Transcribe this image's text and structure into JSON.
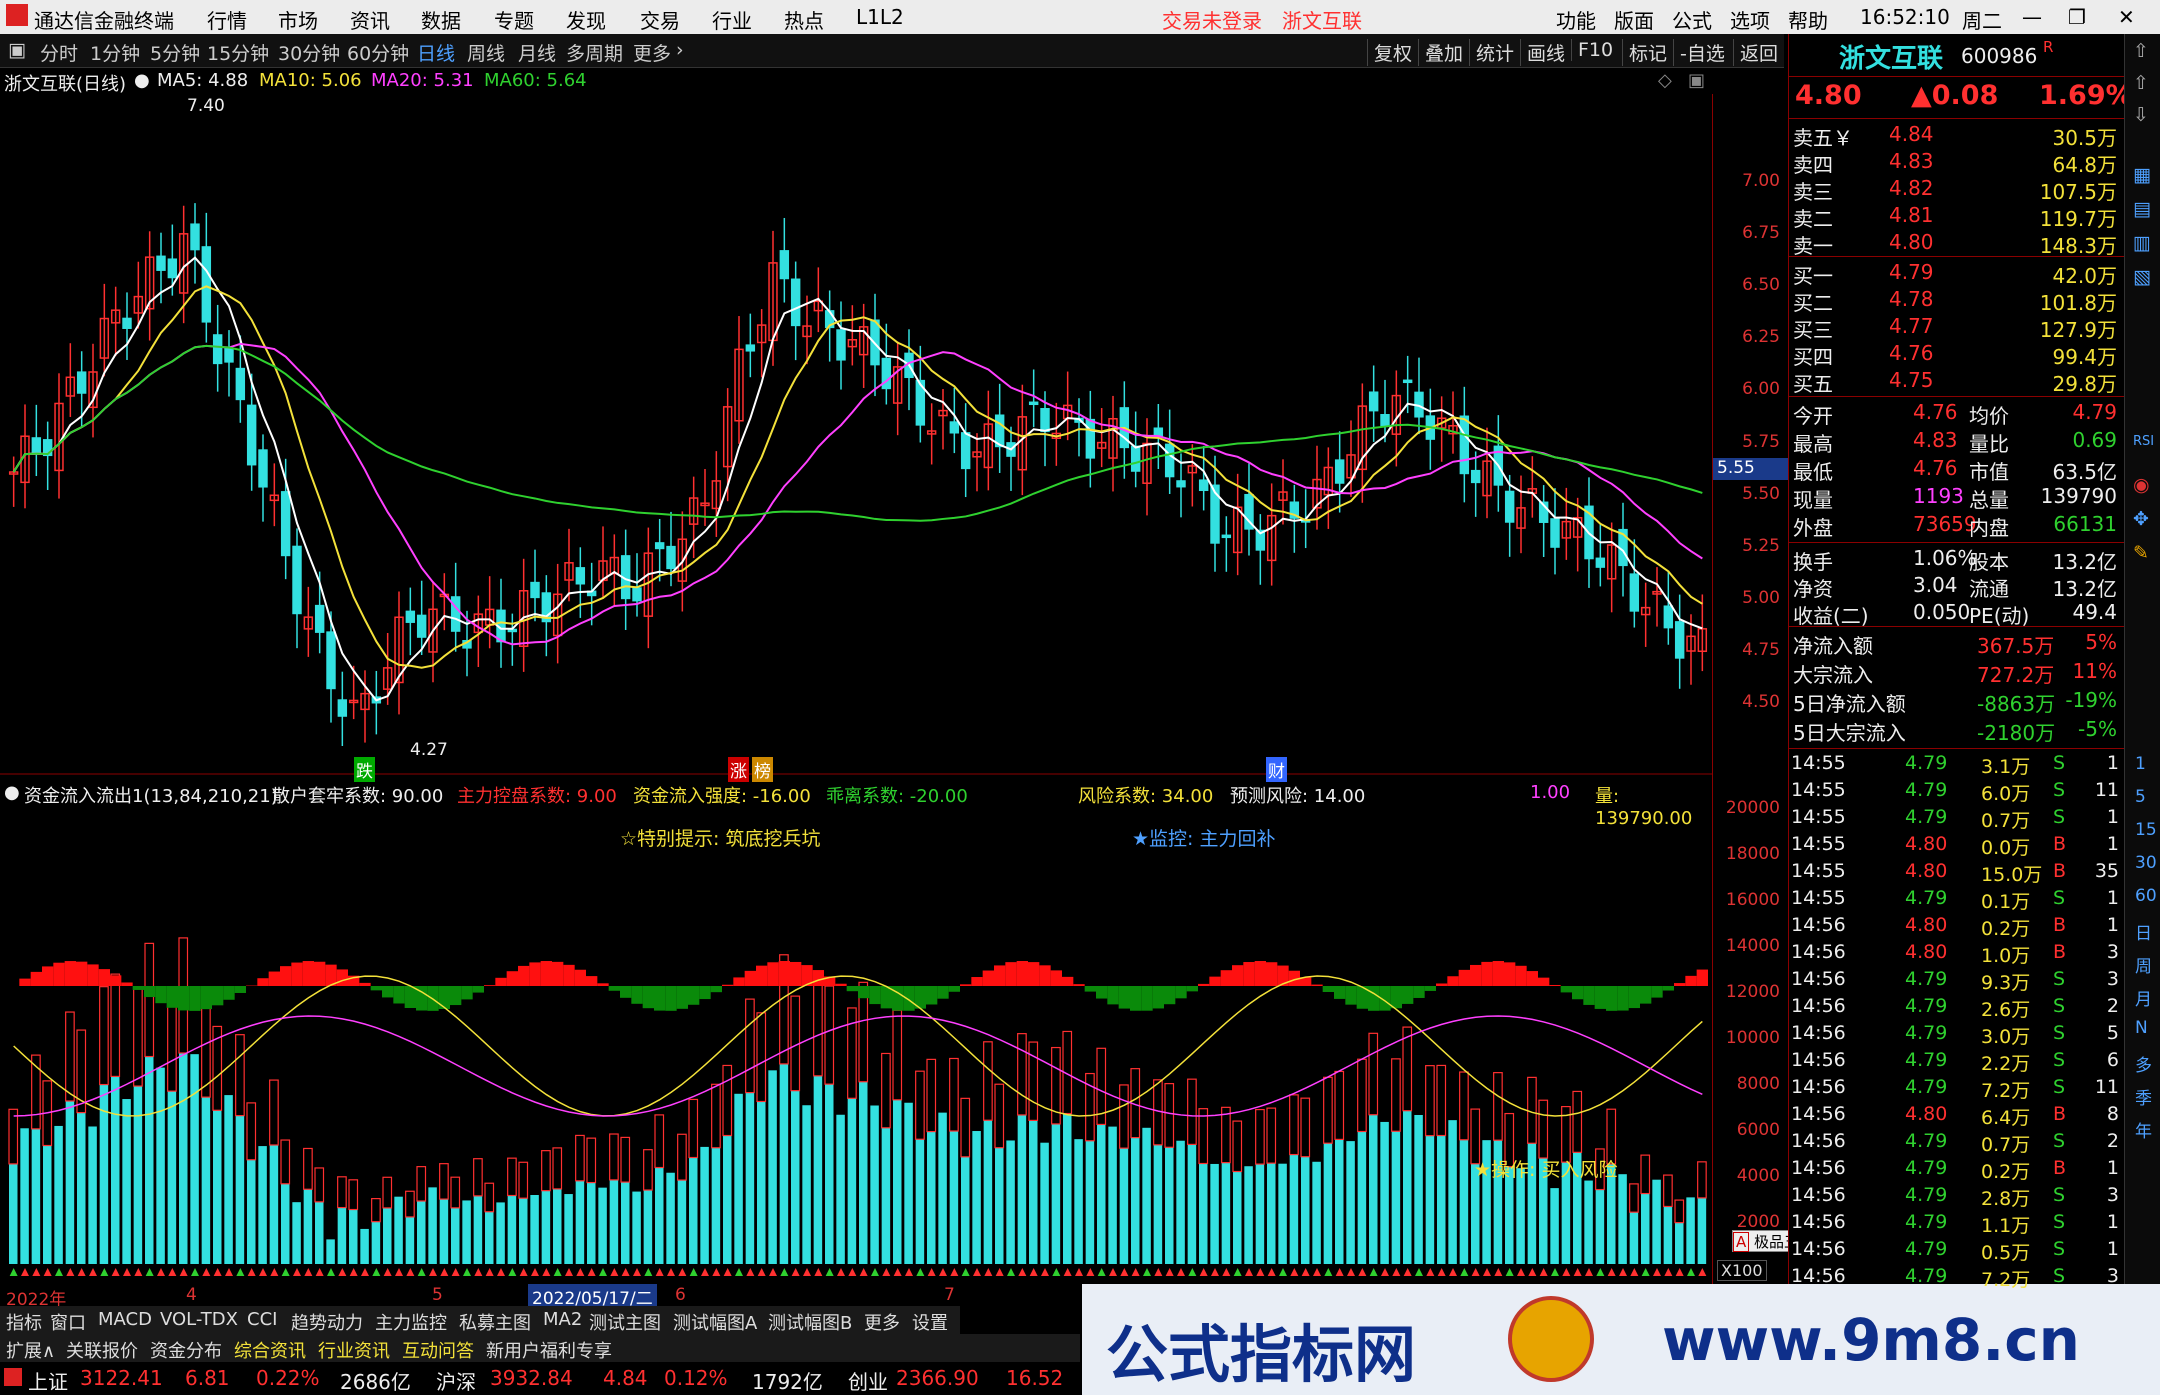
{
  "app": {
    "title": "通达信金融终端",
    "menu": [
      "行情",
      "市场",
      "资讯",
      "数据",
      "专题",
      "发现",
      "交易",
      "行业",
      "热点",
      "L1L2"
    ],
    "trade_status": "交易未登录",
    "stock_link": "浙文互联",
    "right_menu": [
      "功能",
      "版面",
      "公式",
      "选项",
      "帮助"
    ],
    "clock": "16:52:10",
    "weekday": "周二"
  },
  "toolbar": {
    "periods": [
      "分时",
      "1分钟",
      "5分钟",
      "15分钟",
      "30分钟",
      "60分钟",
      "日线",
      "周线",
      "月线",
      "多周期",
      "更多"
    ],
    "active_period": "日线",
    "buttons": [
      "复权",
      "叠加",
      "统计",
      "画线",
      "F10",
      "标记",
      "-自选",
      "返回"
    ]
  },
  "main_info": {
    "name": "浙文互联(日线)",
    "ma5": "MA5: 4.88",
    "ma10": "MA10: 5.06",
    "ma20": "MA20: 5.31",
    "ma60": "MA60: 5.64",
    "high_mark": "7.40",
    "low_mark": "4.27",
    "cur_price_tag": "5.55"
  },
  "y_axis_main": [
    "7.00",
    "6.75",
    "6.50",
    "6.25",
    "6.00",
    "5.75",
    "5.50",
    "5.25",
    "5.00",
    "4.75",
    "4.50"
  ],
  "y_axis_sub": [
    "20000",
    "18000",
    "16000",
    "14000",
    "12000",
    "10000",
    "8000",
    "6000",
    "4000",
    "2000"
  ],
  "x100": "X100",
  "markers": {
    "die": "跌",
    "zhang": "涨",
    "bang": "榜",
    "cai": "财"
  },
  "sub_info": {
    "name": "资金流入流出1(13,84,210,21)",
    "sanhu": "散户套牢系数: 90.00",
    "zhuli": "主力控盘系数: 9.00",
    "liru": "资金流入强度: -16.00",
    "guaili": "乖离系数: -20.00",
    "fengxian": "风险系数: 34.00",
    "yuce": "预测风险: 14.00",
    "ratio": "1.00",
    "liang": "量: 139790.00"
  },
  "annotations": {
    "tip": "☆特别提示: 筑底挖兵坑",
    "jiankong": "★监控: 主力回补",
    "caozuo": "★操作: 买入风险"
  },
  "x_axis": {
    "year": "2022年",
    "m4": "4",
    "m5": "5",
    "date_sel": "2022/05/17/二",
    "m6": "6",
    "m7": "7"
  },
  "tabs_row1": [
    "指标",
    "窗口",
    "MACD",
    "VOL-TDX",
    "CCI",
    "趋势动力",
    "主力监控",
    "私募主图",
    "MA2",
    "测试主图",
    "测试幅图A",
    "测试幅图B",
    "更多",
    "设置"
  ],
  "tabs_row2": [
    "扩展∧",
    "关联报价",
    "资金分布",
    "综合资讯",
    "行业资讯",
    "互动问答",
    "新用户福利专享"
  ],
  "status": {
    "sh_label": "上证",
    "sh_val": "3122.41",
    "sh_chg": "6.81",
    "sh_pct": "0.22%",
    "sh_amt": "2686亿",
    "sz_label": "沪深",
    "sz_val": "3932.84",
    "sz_chg": "4.84",
    "sz_pct": "0.12%",
    "sz_amt": "1792亿",
    "cy_label": "创业",
    "cy_val": "2366.90",
    "cy_chg": "16.52"
  },
  "quote": {
    "name": "浙文互联",
    "code": "600986",
    "flag": "R",
    "price": "4.80",
    "change": "▲0.08",
    "pct": "1.69%",
    "asks": [
      [
        "卖五￥",
        "4.84",
        "30.5万"
      ],
      [
        "卖四",
        "4.83",
        "64.8万"
      ],
      [
        "卖三",
        "4.82",
        "107.5万"
      ],
      [
        "卖二",
        "4.81",
        "119.7万"
      ],
      [
        "卖一",
        "4.80",
        "148.3万"
      ]
    ],
    "bids": [
      [
        "买一",
        "4.79",
        "42.0万"
      ],
      [
        "买二",
        "4.78",
        "101.8万"
      ],
      [
        "买三",
        "4.77",
        "127.9万"
      ],
      [
        "买四",
        "4.76",
        "99.4万"
      ],
      [
        "买五",
        "4.75",
        "29.8万"
      ]
    ],
    "stats": [
      [
        "今开",
        "4.76",
        "均价",
        "4.79"
      ],
      [
        "最高",
        "4.83",
        "量比",
        "0.69"
      ],
      [
        "最低",
        "4.76",
        "市值",
        "63.5亿"
      ],
      [
        "现量",
        "1193",
        "总量",
        "139790"
      ],
      [
        "外盘",
        "73659",
        "内盘",
        "66131"
      ]
    ],
    "fin": [
      [
        "换手",
        "1.06%",
        "股本",
        "13.2亿"
      ],
      [
        "净资",
        "3.04",
        "流通",
        "13.2亿"
      ],
      [
        "收益(二)",
        "0.050",
        "PE(动)",
        "49.4"
      ]
    ],
    "flow": [
      [
        "净流入额",
        "367.5万",
        "5%"
      ],
      [
        "大宗流入",
        "727.2万",
        "11%"
      ],
      [
        "5日净流入额",
        "-8863万",
        "-19%"
      ],
      [
        "5日大宗流入",
        "-2180万",
        "-5%"
      ]
    ]
  },
  "ticks": [
    [
      "14:55",
      "4.79",
      "3.1万",
      "S",
      "1"
    ],
    [
      "14:55",
      "4.79",
      "6.0万",
      "S",
      "11"
    ],
    [
      "14:55",
      "4.79",
      "0.7万",
      "S",
      "1"
    ],
    [
      "14:55",
      "4.80",
      "0.0万",
      "B",
      "1"
    ],
    [
      "14:55",
      "4.80",
      "15.0万",
      "B",
      "35"
    ],
    [
      "14:55",
      "4.79",
      "0.1万",
      "S",
      "1"
    ],
    [
      "14:56",
      "4.80",
      "0.2万",
      "B",
      "1"
    ],
    [
      "14:56",
      "4.80",
      "1.0万",
      "B",
      "3"
    ],
    [
      "14:56",
      "4.79",
      "9.3万",
      "S",
      "3"
    ],
    [
      "14:56",
      "4.79",
      "2.6万",
      "S",
      "2"
    ],
    [
      "14:56",
      "4.79",
      "3.0万",
      "S",
      "5"
    ],
    [
      "14:56",
      "4.79",
      "2.2万",
      "S",
      "6"
    ],
    [
      "14:56",
      "4.79",
      "7.2万",
      "S",
      "11"
    ],
    [
      "14:56",
      "4.80",
      "6.4万",
      "B",
      "8"
    ],
    [
      "14:56",
      "4.79",
      "0.7万",
      "S",
      "2"
    ],
    [
      "14:56",
      "4.79",
      "0.2万",
      "B",
      "1"
    ],
    [
      "14:56",
      "4.79",
      "2.8万",
      "S",
      "3"
    ],
    [
      "14:56",
      "4.79",
      "1.1万",
      "S",
      "1"
    ],
    [
      "14:56",
      "4.79",
      "0.5万",
      "S",
      "1"
    ],
    [
      "14:56",
      "4.79",
      "7.2万",
      "S",
      "3"
    ]
  ],
  "popup": "极品五笔",
  "side_tabs": [
    "1",
    "5",
    "15",
    "30",
    "60",
    "日",
    "周",
    "月",
    "N",
    "多",
    "季",
    "年"
  ],
  "banner": {
    "left": "公式指标网",
    "right": "www.9m8.cn"
  },
  "colors": {
    "up": "#ff3030",
    "down": "#33e0e0",
    "ma5": "#ffffff",
    "ma10": "#f3e13a",
    "ma20": "#ff40ff",
    "ma60": "#2fd12f"
  }
}
